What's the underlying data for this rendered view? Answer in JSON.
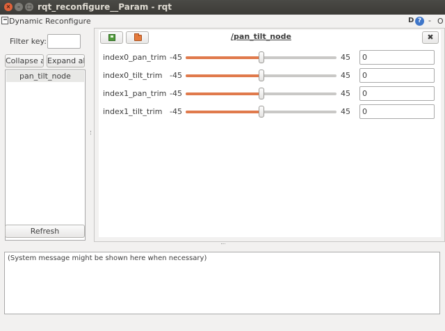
{
  "window": {
    "title": "rqt_reconfigure__Param - rqt",
    "close_glyph": "×",
    "min_glyph": "–",
    "max_glyph": "□"
  },
  "plugin": {
    "title": "Dynamic Reconfigure",
    "icons": [
      "plugin-icon",
      "d-icon",
      "help-icon",
      "minus-icon",
      "close-o-icon"
    ],
    "d_label": "D",
    "help_label": "?",
    "minus_label": "-",
    "o_label": "O"
  },
  "sidebar": {
    "filter_label": "Filter key:",
    "filter_value": "",
    "collapse_label": "Collapse all",
    "expand_label": "Expand all",
    "tree_items": [
      "pan_tilt_node"
    ],
    "refresh_label": "Refresh"
  },
  "node": {
    "title": "/pan_tilt_node",
    "close_label": "✖",
    "params": [
      {
        "name": "index0_pan_trim",
        "min": "-45",
        "max": "45",
        "value": "0"
      },
      {
        "name": "index0_tilt_trim",
        "min": "-45",
        "max": "45",
        "value": "0"
      },
      {
        "name": "index1_pan_trim",
        "min": "-45",
        "max": "45",
        "value": "0"
      },
      {
        "name": "index1_tilt_trim",
        "min": "-45",
        "max": "45",
        "value": "0"
      }
    ]
  },
  "console": {
    "message": "(System message might be shown here when necessary)"
  },
  "colors": {
    "slider_fill": "#e07a4c",
    "titlebar": "#3c3b37",
    "close_button": "#e0623a"
  }
}
